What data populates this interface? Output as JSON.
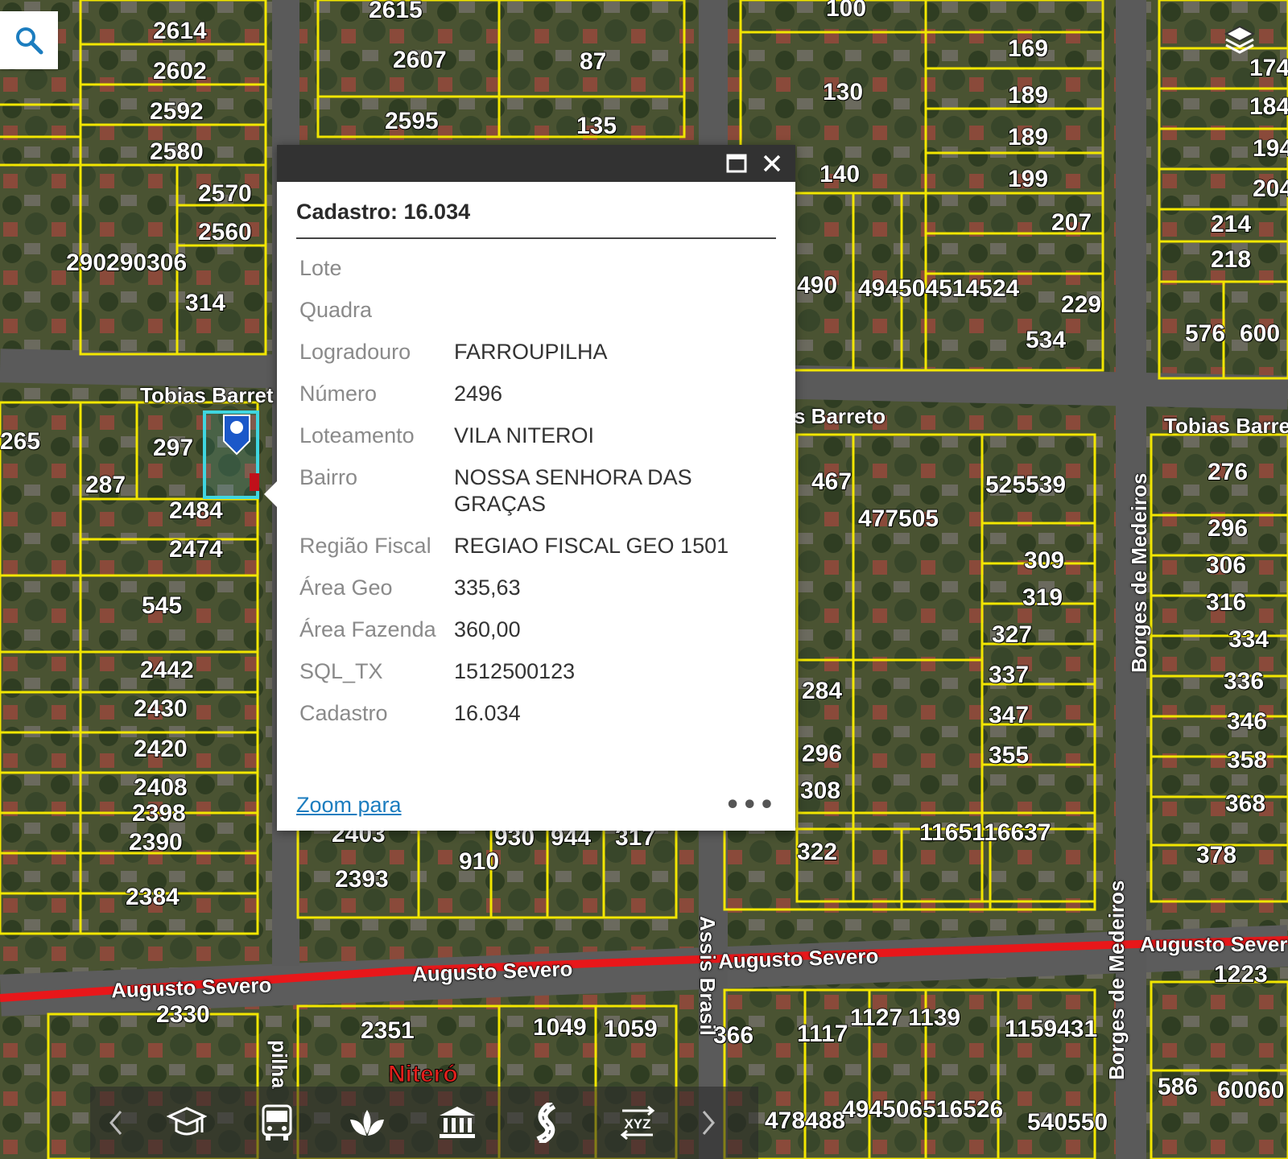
{
  "map": {
    "parcel_numbers": [
      {
        "t": "2614"
      },
      {
        "t": "2602"
      },
      {
        "t": "2592"
      },
      {
        "t": "2580"
      },
      {
        "t": "2570"
      },
      {
        "t": "2560"
      },
      {
        "t": "290290306"
      },
      {
        "t": "314"
      },
      {
        "t": "2615"
      },
      {
        "t": "2607"
      },
      {
        "t": "2595"
      },
      {
        "t": "87"
      },
      {
        "t": "135"
      },
      {
        "t": "100"
      },
      {
        "t": "169"
      },
      {
        "t": "189"
      },
      {
        "t": "189"
      },
      {
        "t": "130"
      },
      {
        "t": "140"
      },
      {
        "t": "199"
      },
      {
        "t": "207"
      },
      {
        "t": "490"
      },
      {
        "t": "494504514524"
      },
      {
        "t": "229"
      },
      {
        "t": "534"
      },
      {
        "t": "174"
      },
      {
        "t": "184"
      },
      {
        "t": "194"
      },
      {
        "t": "204"
      },
      {
        "t": "214"
      },
      {
        "t": "218"
      },
      {
        "t": "576"
      },
      {
        "t": "600"
      },
      {
        "t": "265"
      },
      {
        "t": "297"
      },
      {
        "t": "287"
      },
      {
        "t": "2484"
      },
      {
        "t": "2474"
      },
      {
        "t": "545"
      },
      {
        "t": "2442"
      },
      {
        "t": "2430"
      },
      {
        "t": "2420"
      },
      {
        "t": "2408"
      },
      {
        "t": "2398"
      },
      {
        "t": "2390"
      },
      {
        "t": "2384"
      },
      {
        "t": "467"
      },
      {
        "t": "477505"
      },
      {
        "t": "525539"
      },
      {
        "t": "276"
      },
      {
        "t": "309"
      },
      {
        "t": "319"
      },
      {
        "t": "327"
      },
      {
        "t": "296"
      },
      {
        "t": "306"
      },
      {
        "t": "316"
      },
      {
        "t": "334"
      },
      {
        "t": "337"
      },
      {
        "t": "347"
      },
      {
        "t": "336"
      },
      {
        "t": "346"
      },
      {
        "t": "284"
      },
      {
        "t": "296"
      },
      {
        "t": "355"
      },
      {
        "t": "358"
      },
      {
        "t": "308"
      },
      {
        "t": "368"
      },
      {
        "t": "1165116637"
      },
      {
        "t": "322"
      },
      {
        "t": "378"
      },
      {
        "t": "2403"
      },
      {
        "t": "910"
      },
      {
        "t": "930"
      },
      {
        "t": "944"
      },
      {
        "t": "317"
      },
      {
        "t": "2393"
      },
      {
        "t": "2330"
      },
      {
        "t": "2351"
      },
      {
        "t": "1049"
      },
      {
        "t": "1059"
      },
      {
        "t": "366"
      },
      {
        "t": "1117"
      },
      {
        "t": "1127"
      },
      {
        "t": "1139"
      },
      {
        "t": "1159431"
      },
      {
        "t": "1223"
      },
      {
        "t": "586"
      },
      {
        "t": "60060"
      },
      {
        "t": "478488"
      },
      {
        "t": "494506516526"
      },
      {
        "t": "540550"
      }
    ],
    "streets": {
      "tobias_left": "Tobias Barret",
      "tobias_mid": "s Barreto",
      "tobias_right": "Tobias Barre",
      "augusto_left": "Augusto Severo",
      "augusto_mid": "Augusto Severo",
      "augusto_mid2": "Augusto Severo",
      "augusto_right": "Augusto Sever",
      "borges_top": "Borges de Medeiros",
      "borges_bottom": "Borges de Medeiros",
      "assis": "Assis Brasil",
      "farroupilha_frag": "pilha",
      "niteroi": "Niteró"
    },
    "colors": {
      "lot_lines": "#f2e600",
      "selected_lot": "#3fd6e0",
      "highlight_road": "#e8171a",
      "marker": "#1b58c9"
    }
  },
  "search": {
    "icon": "search-icon"
  },
  "layers": {
    "icon": "layers-icon"
  },
  "popup": {
    "title": "Cadastro: 16.034",
    "rows": [
      {
        "key": "Lote",
        "value": ""
      },
      {
        "key": "Quadra",
        "value": ""
      },
      {
        "key": "Logradouro",
        "value": "FARROUPILHA"
      },
      {
        "key": "Número",
        "value": "2496"
      },
      {
        "key": "Loteamento",
        "value": "VILA NITEROI"
      },
      {
        "key": "Bairro",
        "value": "NOSSA SENHORA DAS GRAÇAS"
      },
      {
        "key": "Região Fiscal",
        "value": "REGIAO FISCAL GEO 1501"
      },
      {
        "key": "Área Geo",
        "value": "335,63"
      },
      {
        "key": "Área Fazenda",
        "value": "360,00"
      },
      {
        "key": "SQL_TX",
        "value": "1512500123"
      },
      {
        "key": "Cadastro",
        "value": "16.034"
      }
    ],
    "zoom_label": "Zoom para",
    "more_label": "•••"
  },
  "toolbar": {
    "items": [
      {
        "icon": "chevron-left-icon"
      },
      {
        "icon": "graduation-cap-icon"
      },
      {
        "icon": "bus-icon"
      },
      {
        "icon": "plant-icon"
      },
      {
        "icon": "institution-icon"
      },
      {
        "icon": "road-icon"
      },
      {
        "icon": "xyz-icon",
        "label": "XYZ"
      },
      {
        "icon": "chevron-right-icon"
      }
    ]
  }
}
